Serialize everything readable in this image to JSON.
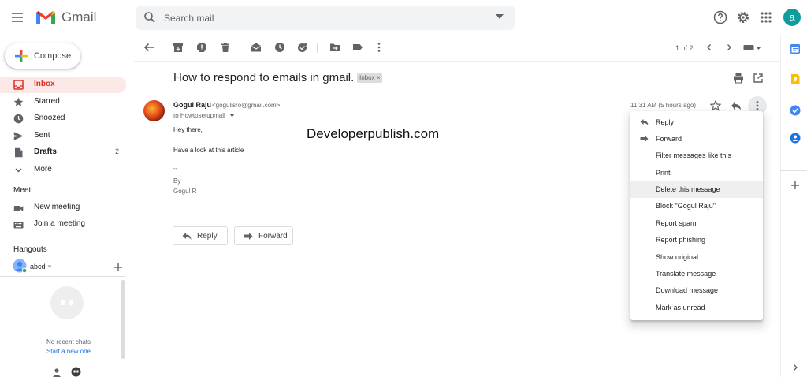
{
  "app": {
    "logo_text": "Gmail",
    "avatar_letter": "a"
  },
  "search": {
    "placeholder": "Search mail"
  },
  "sidebar": {
    "compose_label": "Compose",
    "items": [
      {
        "label": "Inbox",
        "icon": "inbox-icon",
        "count": ""
      },
      {
        "label": "Starred",
        "icon": "star-icon",
        "count": ""
      },
      {
        "label": "Snoozed",
        "icon": "clock-icon",
        "count": ""
      },
      {
        "label": "Sent",
        "icon": "send-icon",
        "count": ""
      },
      {
        "label": "Drafts",
        "icon": "draft-icon",
        "count": "2"
      },
      {
        "label": "More",
        "icon": "chevron-down-icon",
        "count": ""
      }
    ],
    "meet": {
      "title": "Meet",
      "new_meeting": "New meeting",
      "join_meeting": "Join a meeting"
    },
    "hangouts": {
      "title": "Hangouts",
      "user": "abcd",
      "no_chats": "No recent chats",
      "start_new": "Start a new one"
    }
  },
  "toolbar": {
    "pager": "1 of 2"
  },
  "email": {
    "subject": "How to respond to emails in gmail.",
    "label_chip": "Inbox",
    "sender_name": "Gogul Raju",
    "sender_email": "<gogulisro@gmail.com>",
    "to": "to Howtosetupmail",
    "time": "11:31 AM (5 hours ago)",
    "body": {
      "greeting": "Hey there,",
      "line1": "Have a look at this article",
      "dashes": "--",
      "by": "By",
      "signature": "Gogul R"
    },
    "reply_label": "Reply",
    "forward_label": "Forward"
  },
  "watermark": "Developerpublish.com",
  "menu": {
    "items": [
      "Reply",
      "Forward",
      "Filter messages like this",
      "Print",
      "Delete this message",
      "Block \"Gogul Raju\"",
      "Report spam",
      "Report phishing",
      "Show original",
      "Translate message",
      "Download message",
      "Mark as unread"
    ],
    "highlighted": "Delete this message"
  },
  "colors": {
    "inbox_highlight": "#fce8e6",
    "inbox_text": "#d93025",
    "avatar": "#0e9c9c",
    "link": "#1a73e8"
  }
}
